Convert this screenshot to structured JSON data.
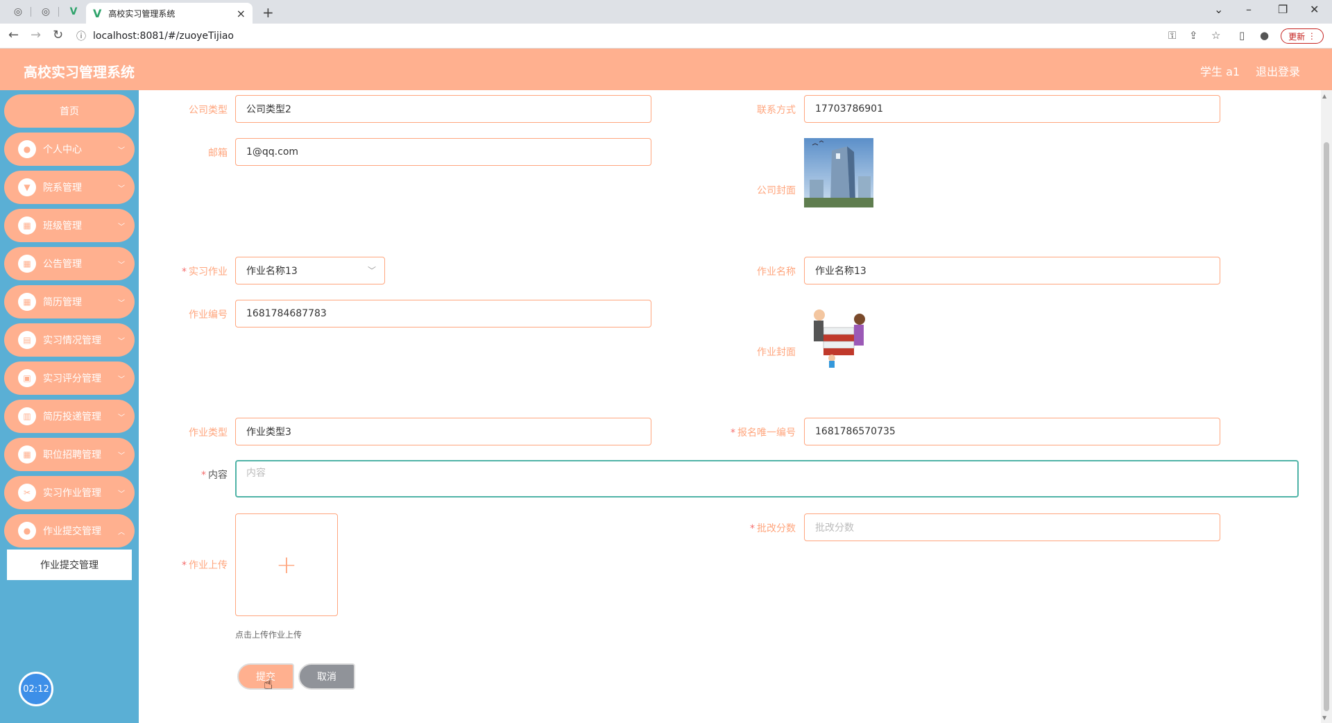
{
  "browser": {
    "tab_title": "高校实习管理系统",
    "url": "localhost:8081/#/zuoyeTijiao",
    "update_label": "更新"
  },
  "header": {
    "app_title": "高校实习管理系统",
    "user": "学生 a1",
    "logout": "退出登录"
  },
  "sidebar": {
    "home": "首页",
    "items": [
      {
        "label": "个人中心"
      },
      {
        "label": "院系管理"
      },
      {
        "label": "班级管理"
      },
      {
        "label": "公告管理"
      },
      {
        "label": "简历管理"
      },
      {
        "label": "实习情况管理"
      },
      {
        "label": "实习评分管理"
      },
      {
        "label": "简历投递管理"
      },
      {
        "label": "职位招聘管理"
      },
      {
        "label": "实习作业管理"
      },
      {
        "label": "作业提交管理"
      }
    ],
    "submenu_active": "作业提交管理",
    "clock": "02:12"
  },
  "form": {
    "company_type": {
      "label": "公司类型",
      "value": "公司类型2"
    },
    "contact": {
      "label": "联系方式",
      "value": "17703786901"
    },
    "email": {
      "label": "邮箱",
      "value": "1@qq.com"
    },
    "company_cover": {
      "label": "公司封面"
    },
    "homework": {
      "label": "实习作业",
      "value": "作业名称13"
    },
    "homework_name": {
      "label": "作业名称",
      "value": "作业名称13"
    },
    "homework_no": {
      "label": "作业编号",
      "value": "1681784687783"
    },
    "homework_cover": {
      "label": "作业封面"
    },
    "homework_type": {
      "label": "作业类型",
      "value": "作业类型3"
    },
    "signup_id": {
      "label": "报名唯一编号",
      "value": "1681786570735"
    },
    "content": {
      "label": "内容",
      "placeholder": "内容"
    },
    "upload": {
      "label": "作业上传",
      "hint": "点击上传作业上传"
    },
    "score": {
      "label": "批改分数",
      "placeholder": "批改分数"
    },
    "submit": "提交",
    "cancel": "取消"
  }
}
